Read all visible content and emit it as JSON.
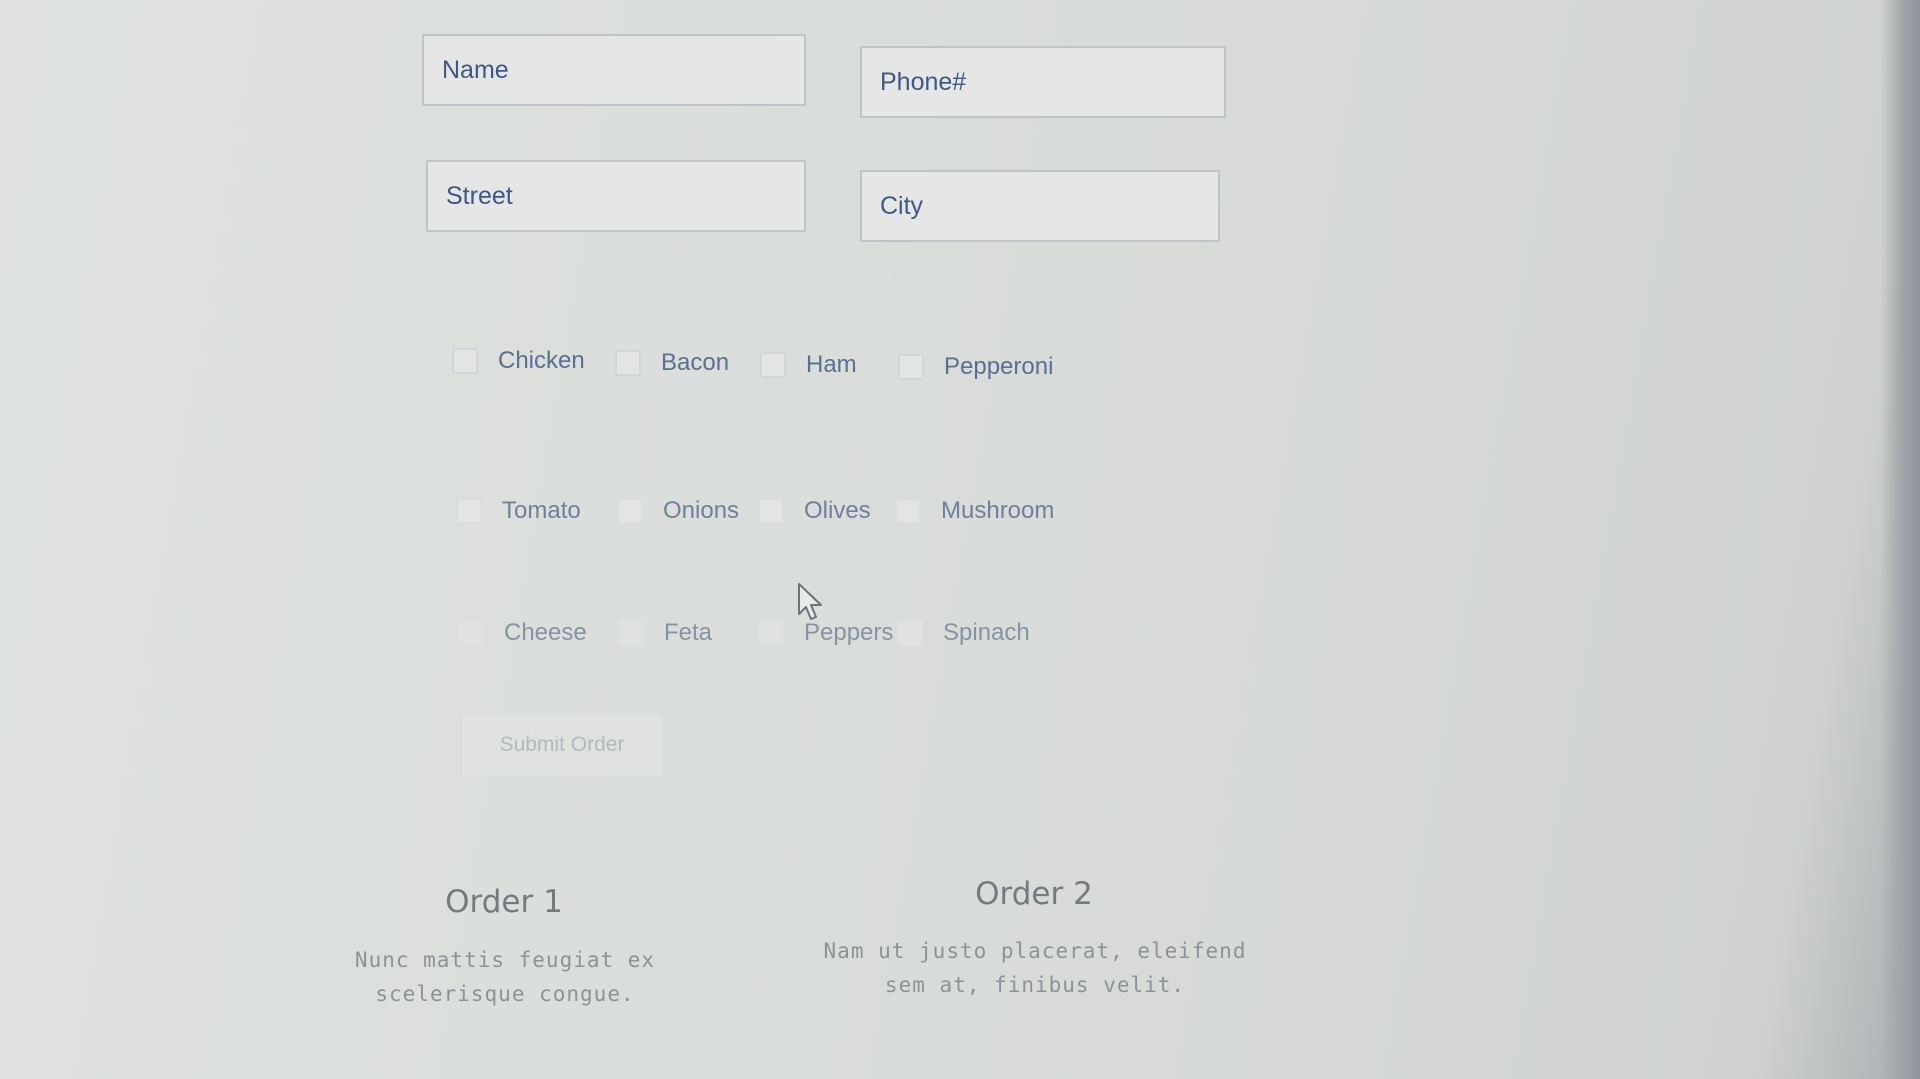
{
  "form": {
    "name": {
      "placeholder": "Name",
      "value": ""
    },
    "phone": {
      "placeholder": "Phone#",
      "value": ""
    },
    "street": {
      "placeholder": "Street",
      "value": ""
    },
    "city": {
      "placeholder": "City",
      "value": ""
    }
  },
  "toppings": {
    "row1": [
      "Chicken",
      "Bacon",
      "Ham",
      "Pepperoni"
    ],
    "row2": [
      "Tomato",
      "Onions",
      "Olives",
      "Mushroom"
    ],
    "row3": [
      "Cheese",
      "Feta",
      "Peppers",
      "Spinach"
    ]
  },
  "submit_label": "Submit Order",
  "orders": [
    {
      "title": "Order 1",
      "line1": "Nunc mattis feugiat ex",
      "line2": "scelerisque congue."
    },
    {
      "title": "Order 2",
      "line1": "Nam ut justo placerat, eleifend",
      "line2": "sem at, finibus velit."
    }
  ],
  "icons": {
    "cursor": "mouse-pointer-icon",
    "checkbox": "checkbox-icon"
  }
}
